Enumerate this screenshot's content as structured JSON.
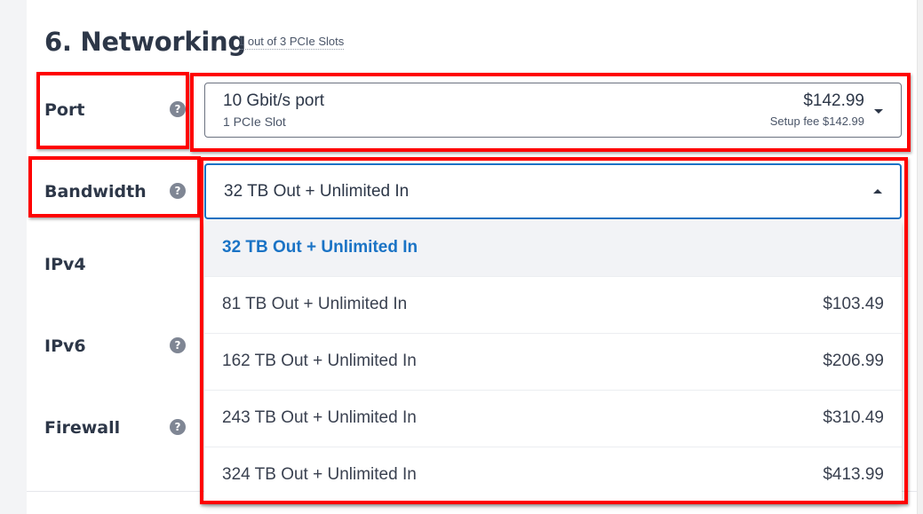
{
  "section": {
    "title": "6. Networking",
    "subtitle": "1 out of 3 PCIe Slots"
  },
  "rows": {
    "port": {
      "label": "Port",
      "help_icon": "question-circle-icon"
    },
    "bandwidth": {
      "label": "Bandwidth",
      "help_icon": "question-circle-icon"
    },
    "ipv4": {
      "label": "IPv4"
    },
    "ipv6": {
      "label": "IPv6",
      "help_icon": "question-circle-icon"
    },
    "firewall": {
      "label": "Firewall",
      "help_icon": "question-circle-icon"
    }
  },
  "help_glyph": "?",
  "port_select": {
    "name": "10 Gbit/s port",
    "sub": "1 PCIe Slot",
    "price": "$142.99",
    "setup_fee": "Setup fee $142.99",
    "icon": "caret-down-icon"
  },
  "bandwidth_select": {
    "value": "32 TB Out + Unlimited In",
    "state": "open",
    "icon": "caret-up-icon",
    "options": [
      {
        "label": "32 TB Out + Unlimited In",
        "price": "",
        "selected": true
      },
      {
        "label": "81 TB Out + Unlimited In",
        "price": "$103.49",
        "selected": false
      },
      {
        "label": "162 TB Out + Unlimited In",
        "price": "$206.99",
        "selected": false
      },
      {
        "label": "243 TB Out + Unlimited In",
        "price": "$310.49",
        "selected": false
      },
      {
        "label": "324 TB Out + Unlimited In",
        "price": "$413.99",
        "selected": false
      }
    ]
  },
  "colors": {
    "accent": "#1a73c5",
    "heading": "#2d3748",
    "annotation": "#ff0000",
    "selected_bg": "#f2f3f6",
    "help_icon_bg": "#7f8694"
  }
}
